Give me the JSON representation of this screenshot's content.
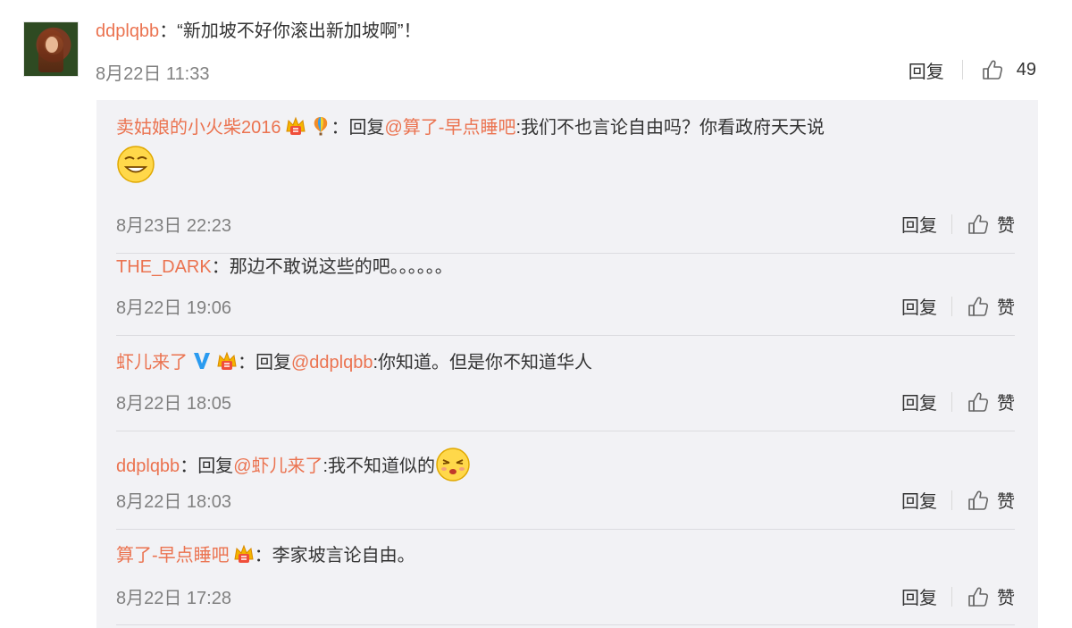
{
  "main": {
    "user": "ddplqbb",
    "text": "：“新加坡不好你滚出新加坡啊”！",
    "time": "8月22日 11:33",
    "reply_label": "回复",
    "like_count": "49"
  },
  "replies": [
    {
      "user": "卖姑娘的小火柴2016",
      "badges": [
        "crown-badge-icon",
        "balloon-badge-icon"
      ],
      "sep": "：",
      "reply_prefix": "回复",
      "mention": "@算了-早点睡吧",
      "text": ":我们不也言论自由吗？你看政府天天说",
      "emoji": "grin-emoji-icon",
      "time": "8月23日 22:23",
      "reply_label": "回复",
      "like_label": "赞"
    },
    {
      "user": "THE_DARK",
      "sep": "：",
      "text": "那边不敢说这些的吧。。。。。。",
      "time": "8月22日 19:06",
      "reply_label": "回复",
      "like_label": "赞"
    },
    {
      "user": "虾儿来了",
      "badges": [
        "verified-v-icon",
        "crown-badge-icon"
      ],
      "sep": "：",
      "reply_prefix": "回复",
      "mention": "@ddplqbb",
      "text": ":你知道。但是你不知道华人",
      "time": "8月22日 18:05",
      "reply_label": "回复",
      "like_label": "赞"
    },
    {
      "user": "ddplqbb",
      "sep": "：",
      "reply_prefix": "回复",
      "mention": "@虾儿来了",
      "text": ":我不知道似的",
      "emoji": "pout-emoji-icon",
      "time": "8月22日 18:03",
      "reply_label": "回复",
      "like_label": "赞"
    },
    {
      "user": "算了-早点睡吧",
      "badges": [
        "crown-badge-icon"
      ],
      "sep": "：",
      "text": "李家坡言论自由。",
      "time": "8月22日 17:28",
      "reply_label": "回复",
      "like_label": "赞"
    }
  ],
  "colors": {
    "username": "#eb7350",
    "timestamp": "#808080",
    "reply_bg": "#f2f2f5"
  }
}
